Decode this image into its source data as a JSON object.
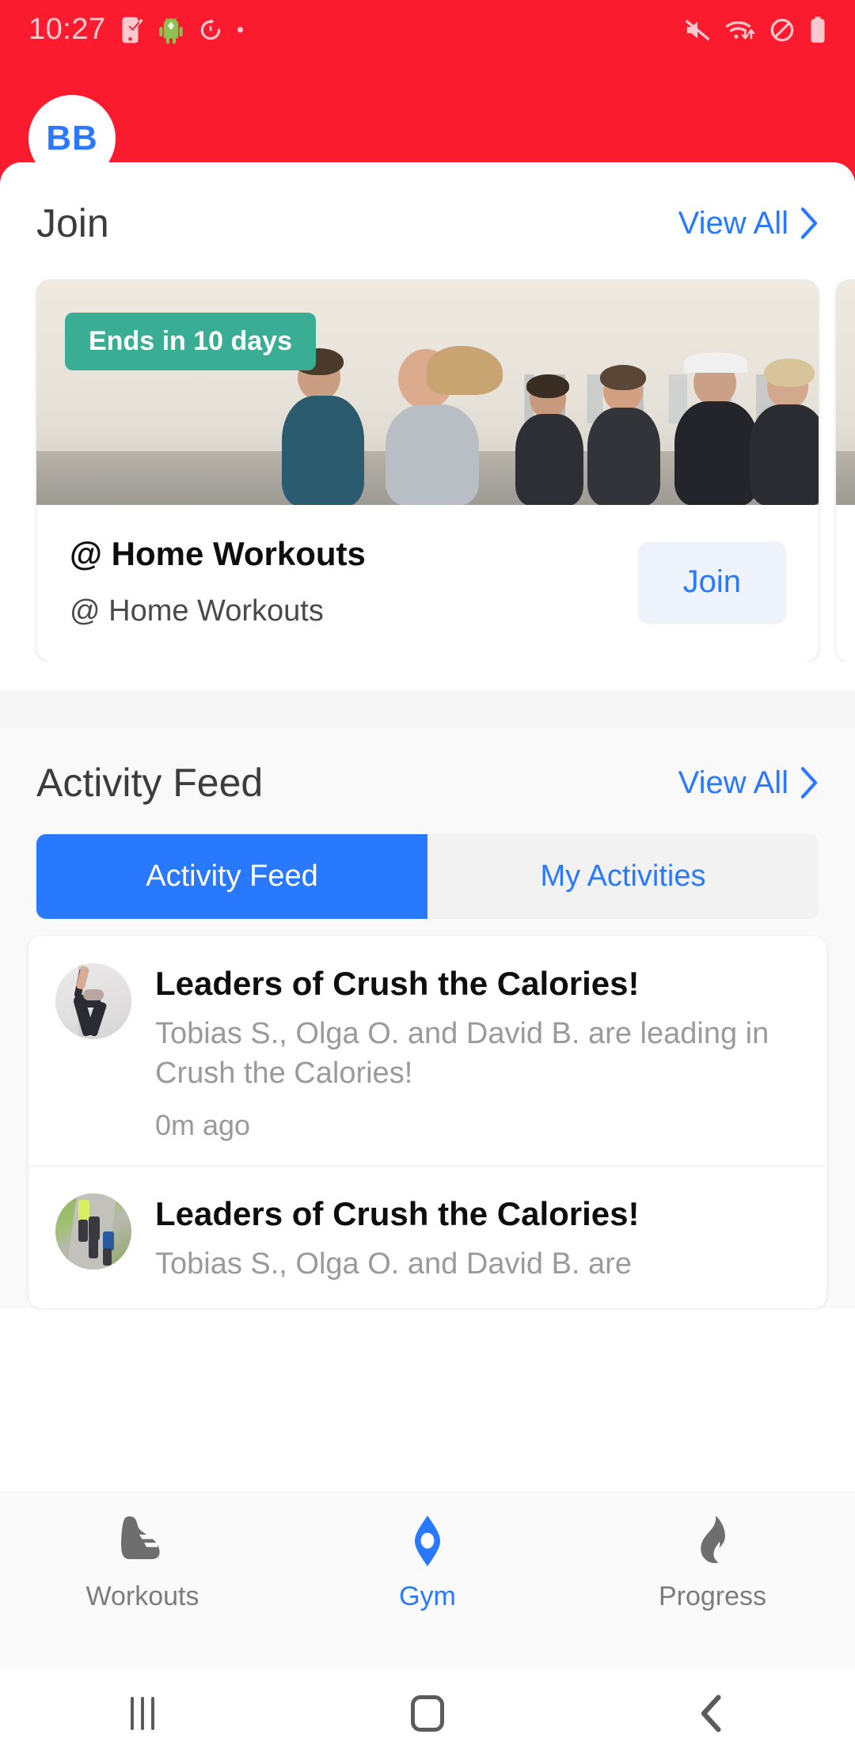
{
  "status_bar": {
    "time": "10:27",
    "icons_left": [
      "phone-check-icon",
      "android-robot-icon",
      "timer-icon",
      "dot-indicator"
    ],
    "icons_right": [
      "mute-icon",
      "wifi-icon",
      "do-not-disturb-icon",
      "battery-icon"
    ]
  },
  "header": {
    "avatar_initials": "BB",
    "brand_color": "#fb1b2e",
    "avatar_text_color": "#2979ff"
  },
  "join_section": {
    "title": "Join",
    "view_all": "View All",
    "chevron": "›",
    "cards": [
      {
        "badge": "Ends in 10 days",
        "badge_color": "#3aae94",
        "name": "@ Home Workouts",
        "subtitle": "@ Home Workouts",
        "action_label": "Join",
        "action_color": "#2979ff",
        "image_alt": "group-of-runners-on-beach"
      }
    ]
  },
  "activity_section": {
    "title": "Activity Feed",
    "view_all": "View All",
    "chevron": "›",
    "tabs": [
      {
        "label": "Activity Feed",
        "active": true
      },
      {
        "label": "My Activities",
        "active": false
      }
    ],
    "items": [
      {
        "title": "Leaders of Crush the Calories!",
        "body": "Tobias S., Olga O. and David B. are leading in Crush the Calories!",
        "time": "0m ago",
        "avatar_alt": "yoga-pose-photo"
      },
      {
        "title": "Leaders of Crush the Calories!",
        "body": "Tobias S., Olga O. and David B. are",
        "time": "",
        "avatar_alt": "runners-on-path-photo"
      }
    ]
  },
  "bottom_nav": {
    "items": [
      {
        "label": "Workouts",
        "icon": "shoe-icon",
        "active": false
      },
      {
        "label": "Gym",
        "icon": "gym-diamond-icon",
        "active": true
      },
      {
        "label": "Progress",
        "icon": "flame-icon",
        "active": false
      }
    ],
    "active_color": "#2979ff",
    "inactive_color": "#7c7c7c"
  },
  "system_nav": {
    "items": [
      "recents-button",
      "home-button",
      "back-button"
    ]
  }
}
